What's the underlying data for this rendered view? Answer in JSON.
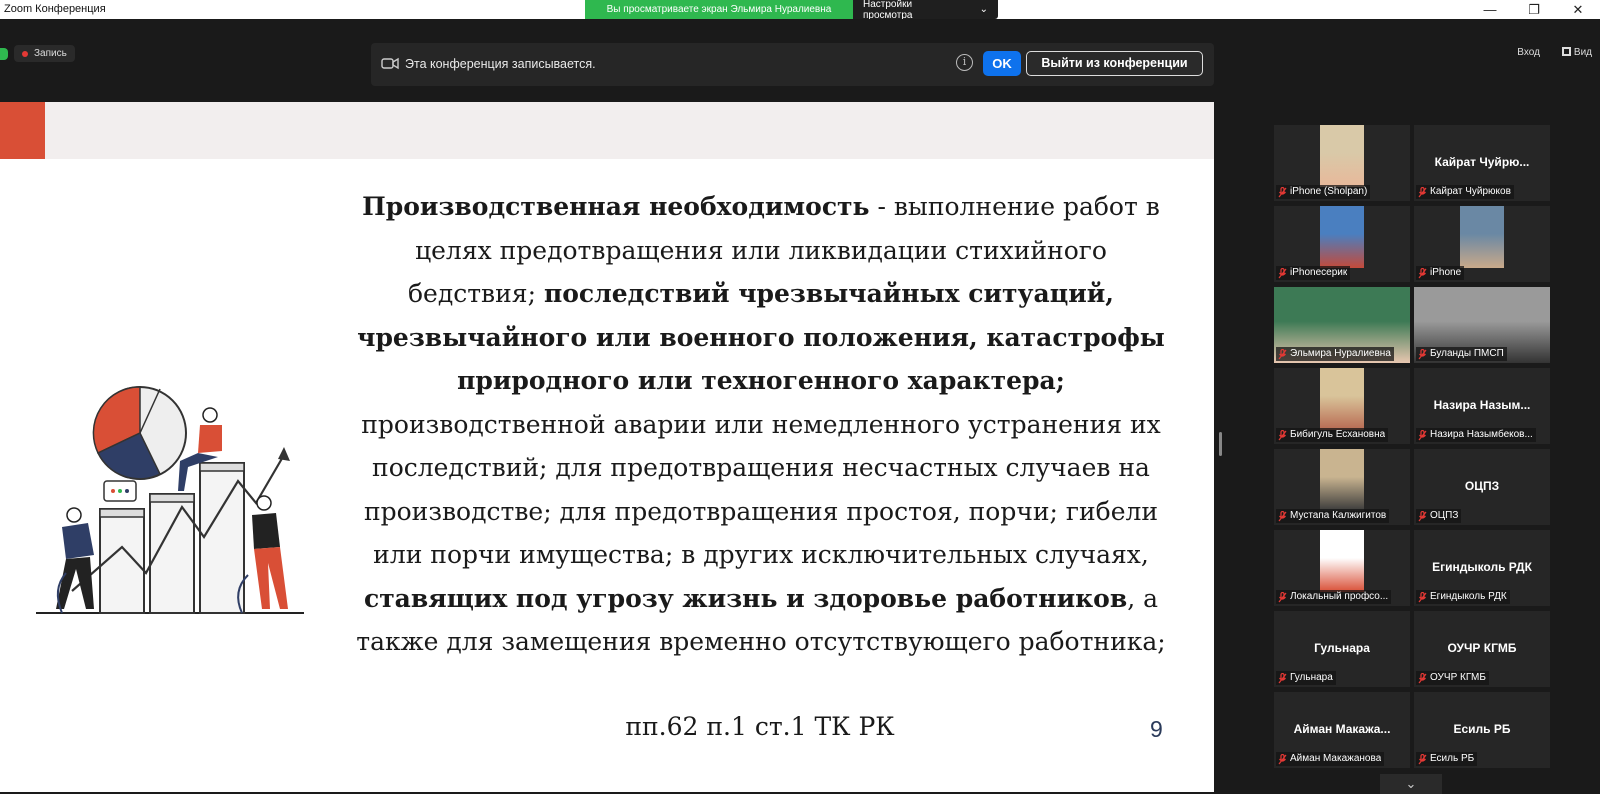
{
  "window": {
    "title": "Zoom Конференция",
    "controls": [
      "minimize",
      "restore",
      "close"
    ]
  },
  "banner": {
    "viewing_text": "Вы просматриваете экран Эльмира Нуралиевна",
    "settings_label": "Настройки просмотра"
  },
  "toolbar": {
    "record_label": "Запись",
    "notice_text": "Эта конференция записывается.",
    "ok_label": "OK",
    "leave_label": "Выйти из конференции",
    "enter_label": "Вход",
    "view_label": "Вид"
  },
  "slide": {
    "text_html_parts": [
      {
        "b": true,
        "t": "Производственная необходимость"
      },
      {
        "b": false,
        "t": " - выполнение работ в целях предотвращения или ликвидации стихийного бедствия; "
      },
      {
        "b": true,
        "t": "последствий чрезвычайных ситуаций, чрезвычайного или военного положения, катастрофы природного или техногенного характера;"
      },
      {
        "b": false,
        "t": " производственной аварии или немедленного устранения их последствий; для предотвращения несчастных случаев на производстве; для предотвращения простоя, порчи; гибели или порчи имущества; в других исключительных случаях, "
      },
      {
        "b": true,
        "t": "ставящих под угрозу жизнь и здоровье работников"
      },
      {
        "b": false,
        "t": ", а также для замещения временно отсутствующего работника;"
      }
    ],
    "reference": "пп.62 п.1 ст.1 ТК РК",
    "page_number": "9"
  },
  "participants": [
    {
      "label": "iPhone (Sholpan)",
      "big_name": "",
      "video": true,
      "active": false
    },
    {
      "label": "Кайрат  Чуйрюков",
      "big_name": "Кайрат  Чуйрю...",
      "video": false,
      "active": false
    },
    {
      "label": "iPhoneсерик",
      "big_name": "",
      "video": true,
      "active": false
    },
    {
      "label": "iPhone",
      "big_name": "",
      "video": true,
      "active": false
    },
    {
      "label": "Эльмира Нуралиевна",
      "big_name": "",
      "video": true,
      "active": true
    },
    {
      "label": "Буланды ПМСП",
      "big_name": "",
      "video": true,
      "active": false
    },
    {
      "label": "Бибигуль Есхановна",
      "big_name": "",
      "video": true,
      "active": false
    },
    {
      "label": "Назира Назымбеков...",
      "big_name": "Назира  Назым...",
      "video": false,
      "active": false
    },
    {
      "label": "Мустапа Калжигитов",
      "big_name": "",
      "video": true,
      "active": false
    },
    {
      "label": "ОЦПЗ",
      "big_name": "ОЦПЗ",
      "video": false,
      "active": false
    },
    {
      "label": "Локальный профсо...",
      "big_name": "",
      "video": true,
      "active": false
    },
    {
      "label": "Егиндыколь РДК",
      "big_name": "Егиндыколь РДК",
      "video": false,
      "active": false
    },
    {
      "label": "Гульнара",
      "big_name": "Гульнара",
      "video": false,
      "active": false
    },
    {
      "label": "ОУЧР КГМБ",
      "big_name": "ОУЧР КГМБ",
      "video": false,
      "active": false
    },
    {
      "label": "Айман Макажанова",
      "big_name": "Айман  Макажа...",
      "video": false,
      "active": false
    },
    {
      "label": "Есиль РБ",
      "big_name": "Есиль РБ",
      "video": false,
      "active": false
    }
  ],
  "colors": {
    "accent_green": "#2fb84f",
    "zoom_blue": "#0e72ed",
    "slide_accent": "#d94f36",
    "active_speaker": "#d8e83a",
    "muted_red": "#e53935"
  }
}
